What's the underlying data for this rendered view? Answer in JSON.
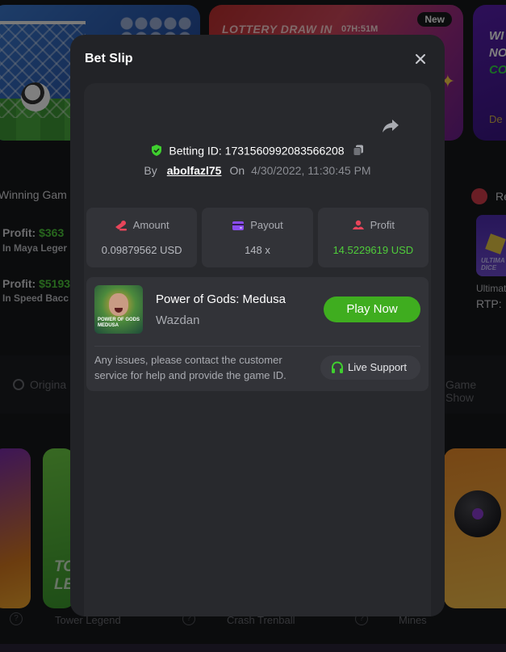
{
  "background": {
    "lottery_banner": {
      "title": "LOTTERY DRAW IN",
      "timer": "07H:51M",
      "badge": "New"
    },
    "promo_banner": {
      "line1": "WI",
      "line2": "NO",
      "line3": "CO",
      "cta": "De"
    },
    "winning_games": {
      "title": "Winning Gam",
      "entries": [
        {
          "profit_label": "Profit:",
          "profit_value": "$363",
          "game": "In Maya Leger"
        },
        {
          "profit_label": "Profit:",
          "profit_value": "$5193",
          "game": "In Speed Bacc"
        }
      ]
    },
    "recommended": {
      "title": "Re",
      "card_text": "ULTIMA DICE",
      "game_name": "Ultimat",
      "rtp": "RTP:"
    },
    "categories": {
      "left": "Origina",
      "right": "Game Show"
    },
    "game_cards": {
      "card2_text": "TO LE",
      "names": [
        "Tower Legend",
        "Crash Trenball",
        "Mines"
      ],
      "help": "?"
    }
  },
  "modal": {
    "title": "Bet Slip",
    "betting_id_label": "Betting ID:",
    "betting_id": "1731560992083566208",
    "by_label": "By",
    "username": "abolfazl75",
    "on_label": "On",
    "datetime": "4/30/2022, 11:30:45 PM",
    "stats": [
      {
        "label": "Amount",
        "value": "0.09879562 USD",
        "icon": "coins-icon"
      },
      {
        "label": "Payout",
        "value": "148 x",
        "icon": "wallet-icon"
      },
      {
        "label": "Profit",
        "value": "14.5229619 USD",
        "icon": "profit-icon"
      }
    ],
    "game": {
      "title": "Power of Gods: Medusa",
      "provider": "Wazdan",
      "thumb_text": "POWER OF GODS MEDUSA",
      "play_label": "Play Now"
    },
    "support_text": "Any issues, please contact the customer service for help and provide the game ID.",
    "support_button": "Live Support"
  },
  "colors": {
    "accent_green": "#3fad1f",
    "profit_green": "#4fcc3a",
    "modal_bg": "#222327",
    "panel_bg": "#28292d",
    "card_bg": "#323338",
    "amount_icon": "#e8455a",
    "payout_icon": "#8a4cf0",
    "profit_icon": "#e8455a"
  }
}
